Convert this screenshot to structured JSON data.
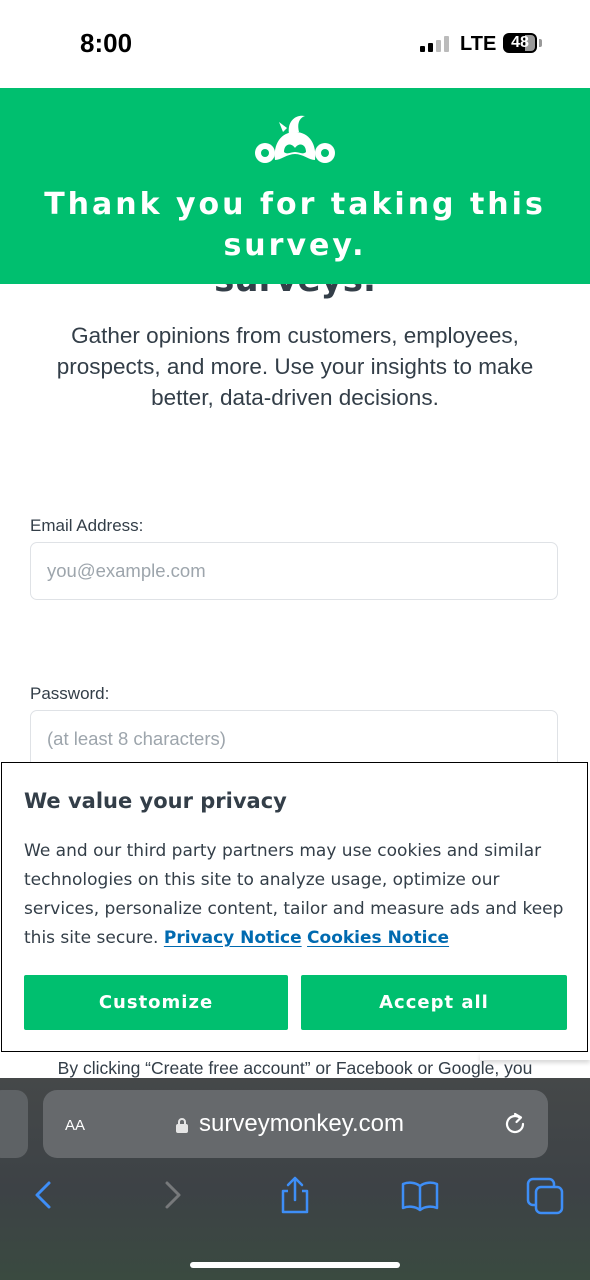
{
  "status_bar": {
    "time": "8:00",
    "network": "LTE",
    "battery": "48"
  },
  "banner": {
    "title": "Thank you for taking this survey.",
    "logo_icon": "surveymonkey-logo-icon"
  },
  "page": {
    "partial_heading": "surveys.",
    "intro": "Gather opinions from customers, employees, prospects, and more. Use your insights to make better, data-driven decisions.",
    "email": {
      "label": "Email Address:",
      "placeholder": "you@example.com"
    },
    "password": {
      "label": "Password:",
      "placeholder": "(at least 8 characters)"
    },
    "terms_partial": "By clicking “Create free account” or Facebook or Google, you"
  },
  "privacy": {
    "title": "We value your privacy",
    "text": "We and our third party partners may use cookies and similar technologies on this site to analyze usage, optimize our services, personalize content, tailor and measure ads and keep this site secure.",
    "privacy_link": "Privacy Notice",
    "cookies_link": "Cookies Notice",
    "customize_label": "Customize",
    "accept_label": "Accept all"
  },
  "browser": {
    "aa_label": "AA",
    "url": "surveymonkey.com",
    "toolbar_icons": [
      "back-icon",
      "forward-icon",
      "share-icon",
      "bookmarks-icon",
      "tabs-icon"
    ]
  },
  "colors": {
    "brand_green": "#00bf6f",
    "text": "#333e48",
    "link": "#006ab0",
    "ios_blue": "#3e8ef7"
  }
}
